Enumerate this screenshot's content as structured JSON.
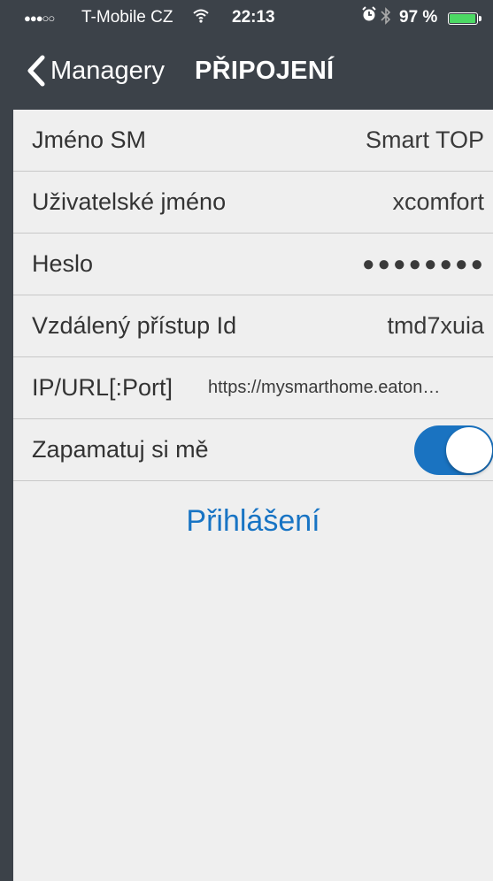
{
  "status_bar": {
    "signal": "●●●○○",
    "carrier": "T-Mobile CZ",
    "wifi_icon": "wifi-icon",
    "time": "22:13",
    "alarm_icon": "alarm-icon",
    "bluetooth_icon": "bluetooth-icon",
    "battery_percent": "97 %",
    "battery_level": 0.97,
    "battery_color": "#4cd964"
  },
  "nav": {
    "back_label": "Managery",
    "title": "PŘIPOJENÍ",
    "background": "#3c4249"
  },
  "form": {
    "rows": [
      {
        "label": "Jméno SM",
        "value": "Smart TOP"
      },
      {
        "label": "Uživatelské jméno",
        "value": "xcomfort"
      },
      {
        "label": "Heslo",
        "value": "●●●●●●●●"
      },
      {
        "label": "Vzdálený přístup Id",
        "value": "tmd7xuia"
      },
      {
        "label": "IP/URL[:Port]",
        "value": "https://mysmarthome.eaton…"
      },
      {
        "label": "Zapamatuj si mě",
        "toggle_on": true
      }
    ]
  },
  "login_label": "Přihlášení",
  "accent_color": "#1874c4"
}
